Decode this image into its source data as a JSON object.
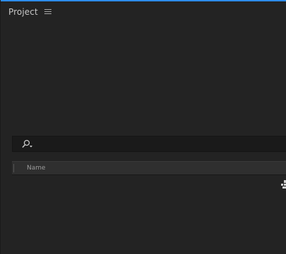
{
  "panel": {
    "title": "Project",
    "menu_icon": "hamburger-icon",
    "accent_color": "#2d8ceb"
  },
  "search": {
    "icon": "search-dropdown-icon",
    "value": ""
  },
  "columns": [
    {
      "label": "Name"
    }
  ],
  "items": [],
  "icons": {
    "flowchart": "flowchart-icon"
  }
}
